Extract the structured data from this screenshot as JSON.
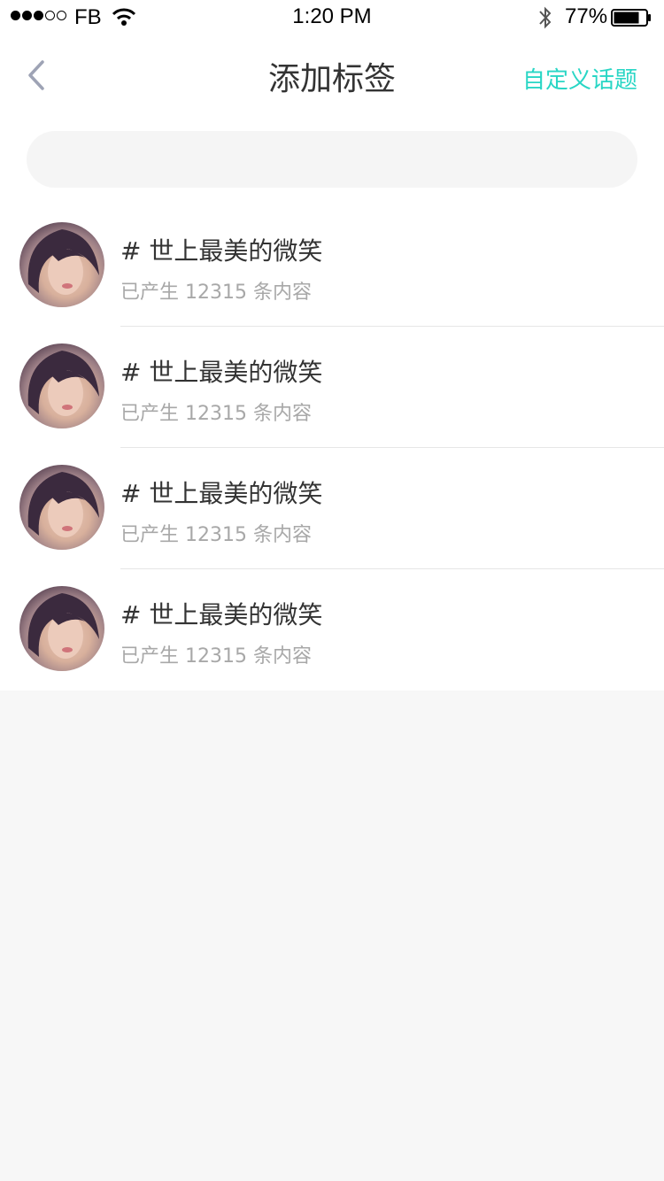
{
  "status_bar": {
    "carrier": "FB",
    "time": "1:20 PM",
    "battery": "77%"
  },
  "nav": {
    "title": "添加标签",
    "action": "自定义话题"
  },
  "search": {
    "placeholder": ""
  },
  "topics": [
    {
      "title": "# 世上最美的微笑",
      "subtitle": "已产生 12315 条内容"
    },
    {
      "title": "# 世上最美的微笑",
      "subtitle": "已产生 12315 条内容"
    },
    {
      "title": "# 世上最美的微笑",
      "subtitle": "已产生 12315 条内容"
    },
    {
      "title": "# 世上最美的微笑",
      "subtitle": "已产生 12315 条内容"
    }
  ],
  "colors": {
    "accent": "#29d6c5",
    "background": "#f7f7f7"
  }
}
